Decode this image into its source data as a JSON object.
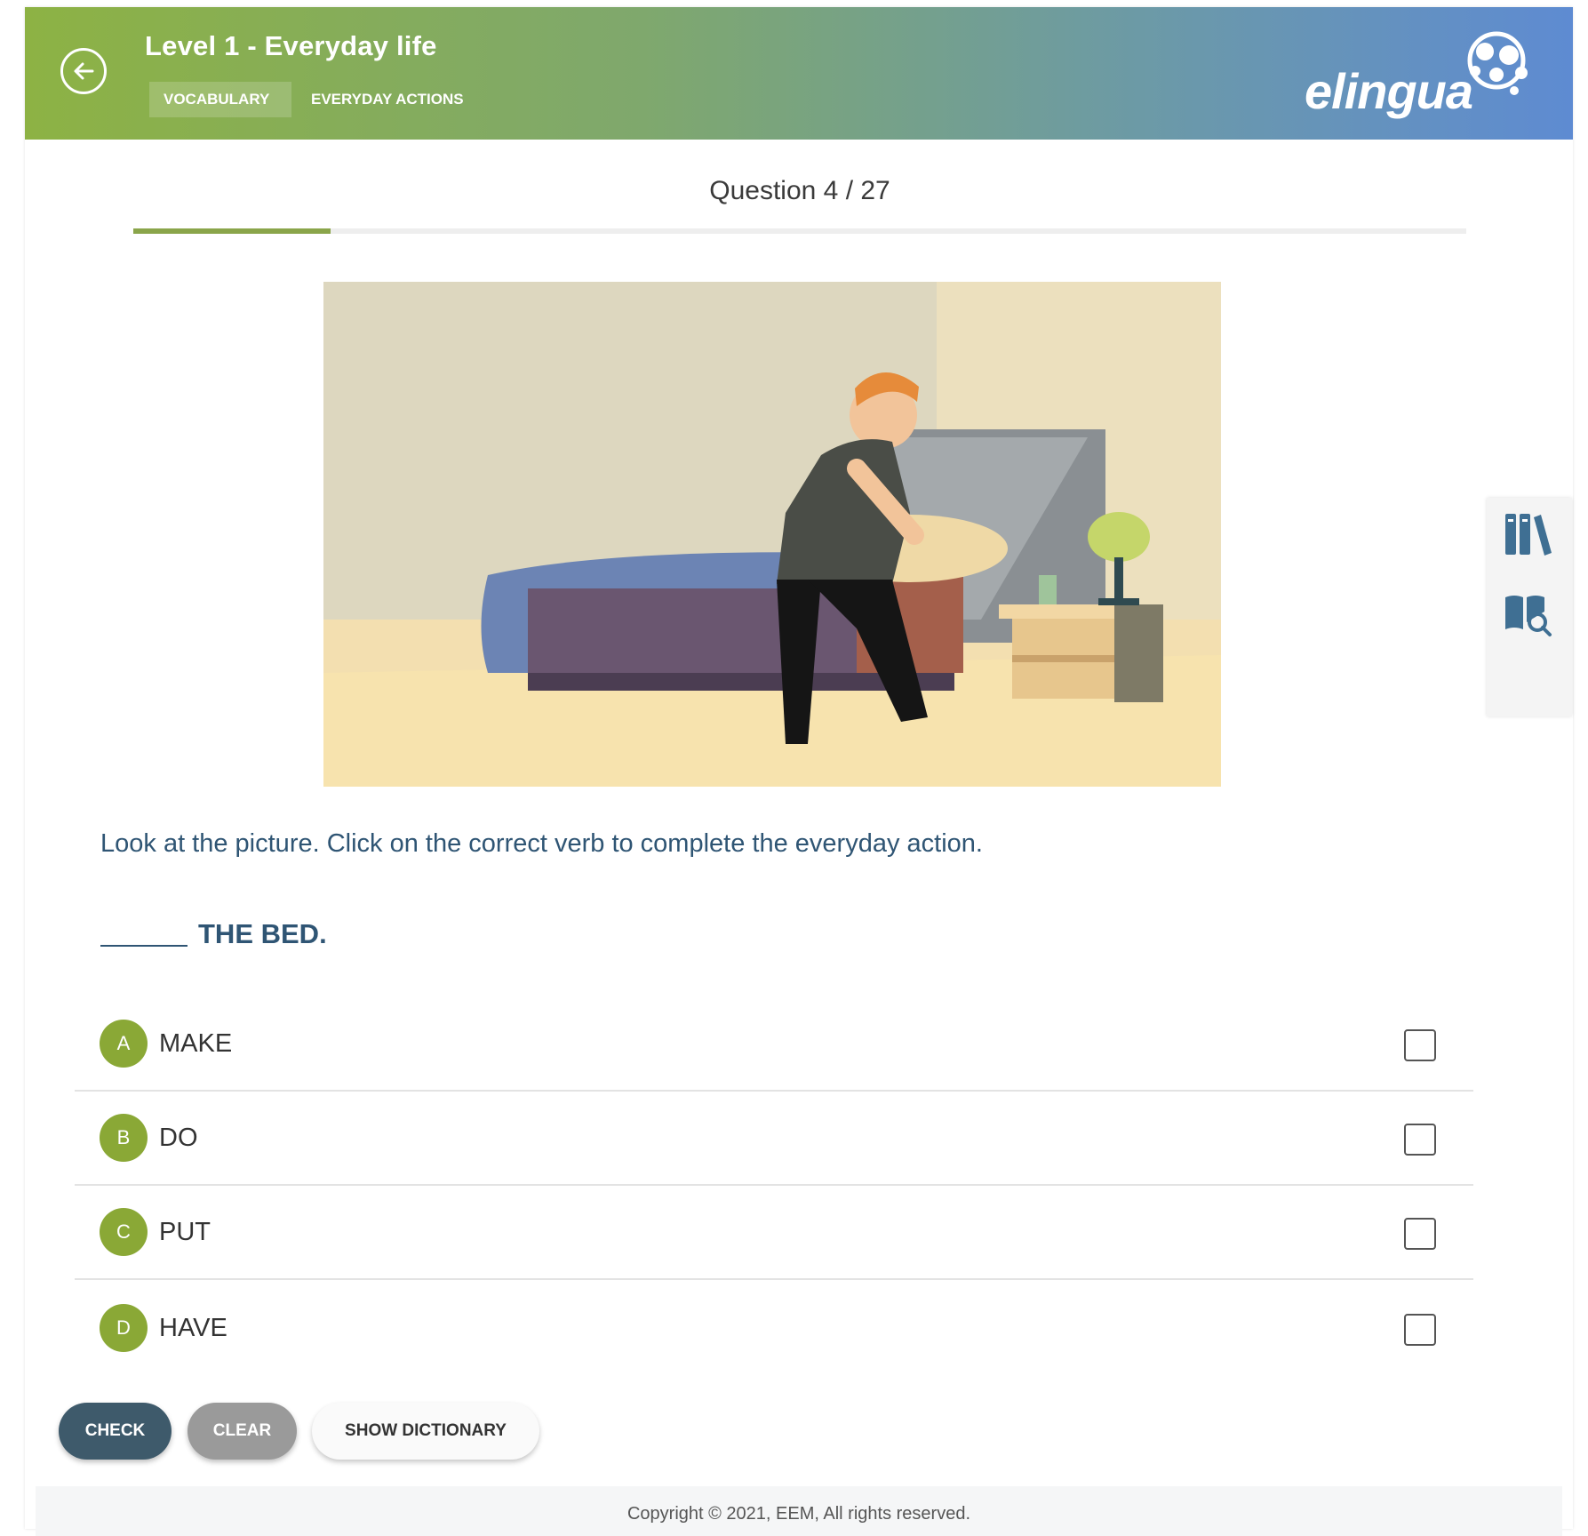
{
  "header": {
    "title": "Level 1 - Everyday life",
    "breadcrumbs": [
      "VOCABULARY",
      "EVERYDAY ACTIONS"
    ],
    "logo_text": "elingua",
    "colors": {
      "start": "#8db244",
      "end": "#5e8bd2"
    }
  },
  "icons": {
    "back": "arrow-left-circle-icon",
    "library": "library-books-icon",
    "dictionary": "book-search-icon"
  },
  "question": {
    "counter": "Question 4 / 27",
    "progress": 0.148,
    "instruction": "Look at the picture. Click on the correct verb to complete the everyday action.",
    "prompt": "THE BED."
  },
  "options": [
    {
      "letter": "A",
      "label": "MAKE",
      "checked": false
    },
    {
      "letter": "B",
      "label": "DO",
      "checked": false
    },
    {
      "letter": "C",
      "label": "PUT",
      "checked": false
    },
    {
      "letter": "D",
      "label": "HAVE",
      "checked": false
    }
  ],
  "buttons": {
    "check": "CHECK",
    "clear": "CLEAR",
    "dictionary": "SHOW DICTIONARY"
  },
  "footer": {
    "copyright": "Copyright © 2021, EEM, All rights reserved."
  }
}
